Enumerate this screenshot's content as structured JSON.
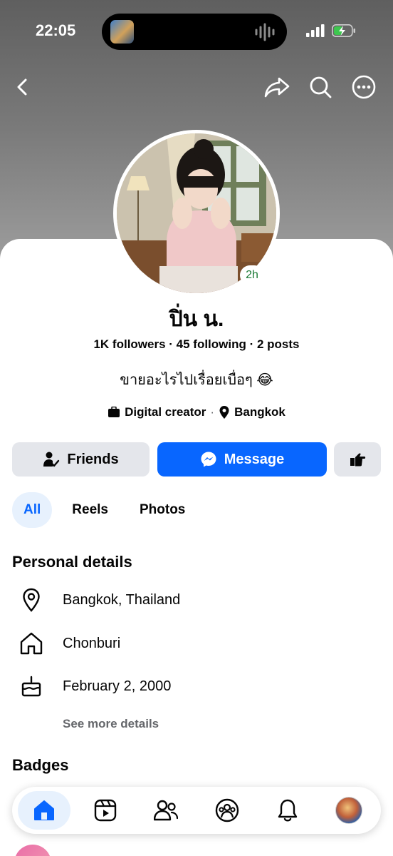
{
  "status_bar": {
    "time": "22:05"
  },
  "profile": {
    "name": "ปิ่น น.",
    "story_age": "2h",
    "stats": "1K followers · 45 following · 2 posts",
    "bio": "ขายอะไรไปเรื่อยเบื่อๆ 😂",
    "category": "Digital creator",
    "meta_separator": "·",
    "location": "Bangkok"
  },
  "actions": {
    "friends_label": "Friends",
    "message_label": "Message"
  },
  "tabs": [
    {
      "label": "All",
      "active": true
    },
    {
      "label": "Reels",
      "active": false
    },
    {
      "label": "Photos",
      "active": false
    }
  ],
  "personal_details": {
    "title": "Personal details",
    "items": [
      {
        "icon": "location-pin-icon",
        "text": "Bangkok, Thailand"
      },
      {
        "icon": "home-icon",
        "text": "Chonburi"
      },
      {
        "icon": "birthday-cake-icon",
        "text": "February 2, 2000"
      }
    ],
    "see_more": "See more details"
  },
  "badges": {
    "title": "Badges"
  },
  "nav": [
    "home-icon",
    "video-icon",
    "friends-icon",
    "groups-icon",
    "notifications-icon",
    "profile-avatar"
  ],
  "colors": {
    "accent": "#0866ff",
    "accent_soft": "#e7f1fd",
    "neutral_button": "#e4e6eb",
    "story_green": "#1a7a35"
  }
}
